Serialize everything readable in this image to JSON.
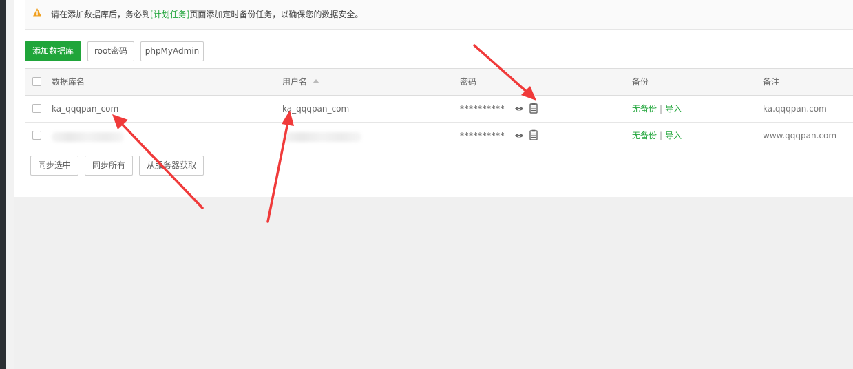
{
  "notice": {
    "prefix": "请在添加数据库后，务必到",
    "link": "[计划任务]",
    "suffix": "页面添加定时备份任务，以确保您的数据安全。"
  },
  "toolbar": {
    "add_db": "添加数据库",
    "root_password": "root密码",
    "phpmyadmin": "phpMyAdmin"
  },
  "table": {
    "headers": {
      "db_name": "数据库名",
      "username": "用户名",
      "password": "密码",
      "backup": "备份",
      "remark": "备注"
    },
    "rows": [
      {
        "db_name": "ka_qqqpan_com",
        "username": "ka_qqqpan_com",
        "password": "**********",
        "backup_status": "无备份",
        "separator": "|",
        "import": "导入",
        "remark": "ka.qqqpan.com"
      },
      {
        "db_name": "",
        "username": "",
        "password": "**********",
        "backup_status": "无备份",
        "separator": "|",
        "import": "导入",
        "remark": "www.qqqpan.com"
      }
    ]
  },
  "footer": {
    "sync_selected": "同步选中",
    "sync_all": "同步所有",
    "fetch_from_server": "从服务器获取"
  },
  "colors": {
    "accent": "#20a53a",
    "annotation_arrow": "#f03a3a",
    "warning": "#f0a020"
  },
  "icons": [
    "warning-icon",
    "eye-icon",
    "copy-icon",
    "sort-up-icon"
  ]
}
